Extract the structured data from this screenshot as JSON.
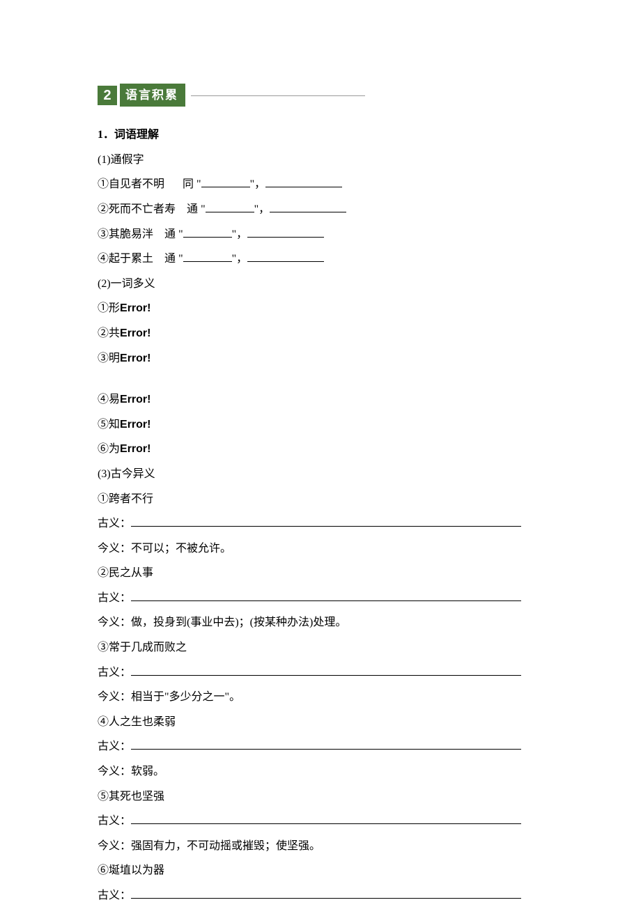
{
  "header": {
    "number": "2",
    "title": "语言积累"
  },
  "q1": {
    "heading": "1．词语理解",
    "sub1": {
      "label": "(1)通假字",
      "items": [
        {
          "num": "①",
          "text": "自见者不明",
          "conn": "同"
        },
        {
          "num": "②",
          "text": "死而不亡者寿",
          "conn": "通"
        },
        {
          "num": "③",
          "text": "其脆易泮",
          "conn": "通"
        },
        {
          "num": "④",
          "text": "起于累土",
          "conn": "通"
        }
      ]
    },
    "sub2": {
      "label": "(2)一词多义",
      "items": [
        {
          "num": "①",
          "word": "形",
          "err": "Error!"
        },
        {
          "num": "②",
          "word": "共",
          "err": "Error!"
        },
        {
          "num": "③",
          "word": "明",
          "err": "Error!"
        },
        {
          "num": "④",
          "word": "易",
          "err": "Error!"
        },
        {
          "num": "⑤",
          "word": "知",
          "err": "Error!"
        },
        {
          "num": "⑥",
          "word": "为",
          "err": "Error!"
        }
      ]
    },
    "sub3": {
      "label": "(3)古今异义",
      "gu_label": "古义：",
      "jin_label": "今义：",
      "items": [
        {
          "num": "①",
          "phrase": "跨者不行",
          "modern": "不可以；不被允许。"
        },
        {
          "num": "②",
          "phrase": "民之从事",
          "modern": "做，投身到(事业中去)；(按某种办法)处理。"
        },
        {
          "num": "③",
          "phrase": "常于几成而败之",
          "modern": "相当于\"多少分之一\"。"
        },
        {
          "num": "④",
          "phrase": "人之生也柔弱",
          "modern": "软弱。"
        },
        {
          "num": "⑤",
          "phrase": "其死也坚强",
          "modern": "强固有力，不可动摇或摧毁；使坚强。"
        },
        {
          "num": "⑥",
          "phrase": "埏埴以为器",
          "modern": ""
        }
      ]
    }
  }
}
